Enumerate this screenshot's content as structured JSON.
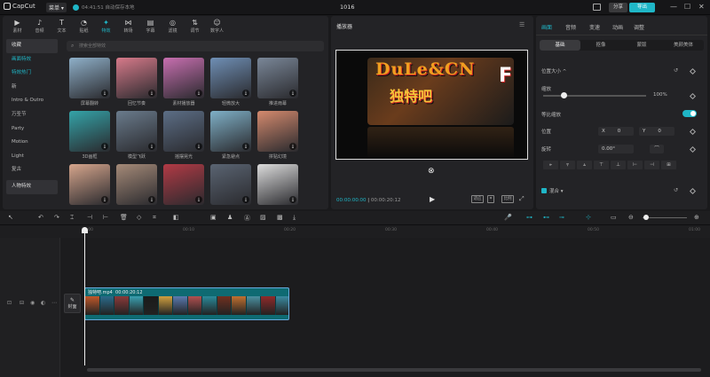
{
  "app": {
    "logo": "CapCut",
    "menu_label": "菜单",
    "autosave": "04:41:51 自动保存本地",
    "title": "1016",
    "share_label": "分享",
    "export_label": "导出"
  },
  "tools": [
    {
      "label": "素材",
      "icon": "▶"
    },
    {
      "label": "音频",
      "icon": "♪"
    },
    {
      "label": "文本",
      "icon": "T"
    },
    {
      "label": "贴纸",
      "icon": "◔"
    },
    {
      "label": "特效",
      "icon": "✦"
    },
    {
      "label": "转场",
      "icon": "⋈"
    },
    {
      "label": "字幕",
      "icon": "▤"
    },
    {
      "label": "滤镜",
      "icon": "◎"
    },
    {
      "label": "调节",
      "icon": "⇅"
    },
    {
      "label": "数字人",
      "icon": "☺"
    }
  ],
  "categories": [
    {
      "label": "收藏",
      "state": "sel"
    },
    {
      "label": "画面特效",
      "state": "hl"
    },
    {
      "label": "特效热门",
      "state": "hl"
    },
    {
      "label": "新",
      "state": ""
    },
    {
      "label": "Intro & Outro",
      "state": ""
    },
    {
      "label": "万圣节",
      "state": ""
    },
    {
      "label": "Party",
      "state": ""
    },
    {
      "label": "Motion",
      "state": ""
    },
    {
      "label": "Light",
      "state": ""
    },
    {
      "label": "复古",
      "state": ""
    },
    {
      "label": "人物特效",
      "state": "sel"
    }
  ],
  "search_placeholder": "搜索全部特效",
  "effects": [
    {
      "label": "屏幕翻转",
      "color": "#8fb0c9"
    },
    {
      "label": "回忆节奏",
      "color": "#d77a8a"
    },
    {
      "label": "素材播放器",
      "color": "#c86fb0"
    },
    {
      "label": "轻微放大",
      "color": "#6f8fb5"
    },
    {
      "label": "推进雨幕",
      "color": "#7a8798"
    },
    {
      "label": "3D画框",
      "color": "#34a3a8"
    },
    {
      "label": "模型飞跃",
      "color": "#6a7b8c"
    },
    {
      "label": "摇摆晃光",
      "color": "#5c6e86"
    },
    {
      "label": "紧急避点",
      "color": "#7fb0c7"
    },
    {
      "label": "拼贴幻境",
      "color": "#d58a6e"
    },
    {
      "label": "",
      "color": "#d6a58c"
    },
    {
      "label": "",
      "color": "#a58a78"
    },
    {
      "label": "",
      "color": "#b23a45"
    },
    {
      "label": "",
      "color": "#5a6472"
    },
    {
      "label": "",
      "color": "#dcdcdc"
    }
  ],
  "player": {
    "title": "播放器",
    "current_time": "00:00:00:00",
    "total_time": "00:00:20:12",
    "ratio_label": "适应",
    "ratio2_label": "比例",
    "video_text_top": "DuLe&CN",
    "video_text_bottom": "独特吧"
  },
  "right_panel": {
    "tabs": [
      "画面",
      "音频",
      "变速",
      "动画",
      "调整"
    ],
    "subtabs": [
      "基础",
      "抠像",
      "蒙版",
      "美颜美体"
    ],
    "position_size_label": "位置大小",
    "scale_label": "缩放",
    "scale_value": "100%",
    "scale_level": 1.0,
    "uniform_label": "等比缩放",
    "position_label": "位置",
    "x_label": "X",
    "x_value": "0",
    "y_label": "Y",
    "y_value": "0",
    "rotate_label": "旋转",
    "rotate_value": "0.00°",
    "mix_label": "混合"
  },
  "timeline": {
    "ticks": [
      "00:00",
      "00:10",
      "00:20",
      "00:30",
      "00:40",
      "00:50",
      "01:00"
    ],
    "clip_name": "独特吧.mp4",
    "clip_duration": "00:00:20:12",
    "cover_label": "封面"
  },
  "colors": {
    "accent": "#1fb6c7",
    "panel": "#232326",
    "background": "#1a1a1c"
  }
}
